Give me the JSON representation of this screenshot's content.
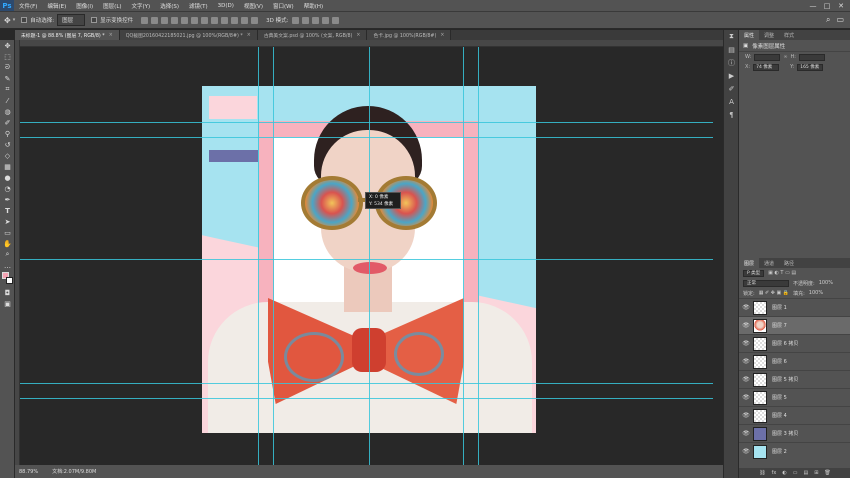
{
  "app": {
    "logo": "Ps",
    "menu": [
      "文件(F)",
      "编辑(E)",
      "图像(I)",
      "图层(L)",
      "文字(Y)",
      "选择(S)",
      "滤镜(T)",
      "3D(D)",
      "视图(V)",
      "窗口(W)",
      "帮助(H)"
    ],
    "window_controls": [
      "—",
      "□",
      "✕"
    ]
  },
  "options_bar": {
    "auto_select_label": "自动选择:",
    "auto_select_value": "图层",
    "show_transform_label": "显示变换控件",
    "mode_3d_label": "3D 模式:"
  },
  "tabs": [
    {
      "label": "未标题-1 @ 88.8% (图层 7, RGB/8) *",
      "active": true
    },
    {
      "label": "QQ截图20160422185021.jpg @ 100%(RGB/8#) *",
      "active": false
    },
    {
      "label": "古典美文案.psd @ 100% (文案, RGB/8)",
      "active": false
    },
    {
      "label": "色卡.jpg @ 100%(RGB/8#)",
      "active": false
    }
  ],
  "tooltip": {
    "line1": "X: 0 像素",
    "line2": "Y: 534 像素"
  },
  "status": {
    "zoom": "88.79%",
    "doc": "文档:2.07M/9.80M"
  },
  "properties": {
    "tabs": [
      "属性",
      "调整",
      "样式"
    ],
    "title": "像素图层属性",
    "w_label": "W:",
    "h_label": "H:",
    "link_icon": "∞",
    "x_label": "X:",
    "x_value": "74 像素",
    "y_label": "Y:",
    "y_value": "165 像素"
  },
  "layers": {
    "tabs": [
      "图层",
      "通道",
      "路径"
    ],
    "filter": "P 类型",
    "blend_mode": "正常",
    "opacity_label": "不透明度:",
    "opacity_value": "100%",
    "lock_label": "锁定:",
    "fill_label": "填充:",
    "fill_value": "100%",
    "items": [
      {
        "name": "图层 1",
        "thumb": "trans",
        "selected": false
      },
      {
        "name": "图层 7",
        "thumb": "portrait",
        "selected": true
      },
      {
        "name": "图层 6 拷贝",
        "thumb": "trans",
        "selected": false
      },
      {
        "name": "图层 6",
        "thumb": "trans",
        "selected": false
      },
      {
        "name": "图层 5 拷贝",
        "thumb": "trans",
        "selected": false
      },
      {
        "name": "图层 5",
        "thumb": "trans",
        "selected": false
      },
      {
        "name": "图层 4",
        "thumb": "trans",
        "selected": false
      },
      {
        "name": "图层 3 拷贝",
        "thumb": "purple",
        "selected": false
      },
      {
        "name": "图层 2",
        "thumb": "blue",
        "selected": false
      }
    ],
    "footer": [
      "fx",
      "◐",
      "▭",
      "▤",
      "⊞",
      "🗑"
    ]
  },
  "colors": {
    "bg_blue": "#a6e3f0",
    "bg_pink": "#fbd6dc",
    "accent_purple": "#6c70a8",
    "guide": "#37c5da"
  }
}
